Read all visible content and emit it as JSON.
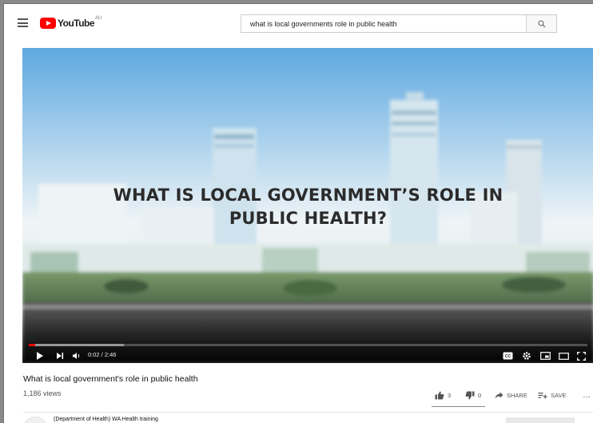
{
  "header": {
    "logo_text": "YouTube",
    "region": "AU",
    "search": {
      "value": "what is local governments role in public health",
      "placeholder": "Search"
    }
  },
  "player": {
    "overlay_title_line1": "WHAT IS LOCAL GOVERNMENT’S ROLE IN",
    "overlay_title_line2": "PUBLIC HEALTH?",
    "time_display": "0:02 / 2:46",
    "progress_played_fraction": 0.012,
    "progress_loaded_fraction": 0.17
  },
  "video": {
    "title": "What is local government's role in public health",
    "views": "1,186 views",
    "likes": "3",
    "dislikes": "0",
    "share_label": "SHARE",
    "save_label": "SAVE",
    "more_label": "…"
  },
  "channel": {
    "name": "(Department of Health) WA Health training"
  },
  "icons": {
    "menu": "menu-icon",
    "search": "search-icon",
    "play": "play-icon",
    "next": "next-icon",
    "volume": "volume-icon",
    "captions": "captions-icon",
    "settings": "gear-icon",
    "miniplayer": "miniplayer-icon",
    "theater": "theater-icon",
    "fullscreen": "fullscreen-icon",
    "like": "thumbs-up-icon",
    "dislike": "thumbs-down-icon",
    "share": "share-icon",
    "save": "save-playlist-icon"
  }
}
